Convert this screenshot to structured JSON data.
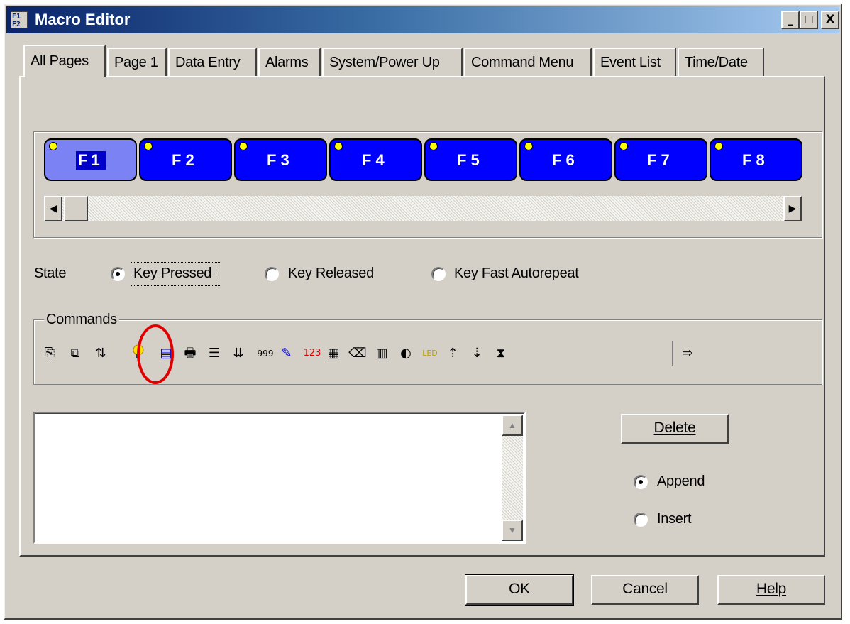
{
  "window": {
    "title": "Macro Editor",
    "icon_text": "F1\nF2",
    "caption_buttons": [
      "_",
      "□",
      "X"
    ]
  },
  "tabs": [
    {
      "label": "All Pages",
      "active": true
    },
    {
      "label": "Page 1"
    },
    {
      "label": "Data Entry"
    },
    {
      "label": "Alarms"
    },
    {
      "label": "System/Power Up"
    },
    {
      "label": "Command Menu"
    },
    {
      "label": "Event List"
    },
    {
      "label": "Time/Date"
    }
  ],
  "function_keys": [
    {
      "label": "F1",
      "selected": true
    },
    {
      "label": "F2"
    },
    {
      "label": "F3"
    },
    {
      "label": "F4"
    },
    {
      "label": "F5"
    },
    {
      "label": "F6"
    },
    {
      "label": "F7"
    },
    {
      "label": "F8"
    }
  ],
  "scroll": {
    "left_arrow": "◀",
    "right_arrow": "▶"
  },
  "state": {
    "label": "State",
    "options": [
      {
        "label": "Key Pressed",
        "selected": true
      },
      {
        "label": "Key Released",
        "selected": false
      },
      {
        "label": "Key Fast Autorepeat",
        "selected": false
      }
    ]
  },
  "commands": {
    "label": "Commands",
    "icons": [
      {
        "name": "goto-page-icon",
        "glyph": "⎘"
      },
      {
        "name": "copy-page-icon",
        "glyph": "⧉"
      },
      {
        "name": "set-tag-icon",
        "glyph": "⇅"
      },
      {
        "name": "light-bulb-icon",
        "glyph": "💡",
        "color": "#e6c000"
      },
      {
        "name": "display-window-icon",
        "glyph": "▤",
        "color": "#0000c0"
      },
      {
        "name": "print-icon",
        "glyph": "🖶"
      },
      {
        "name": "document-icon",
        "glyph": "☰"
      },
      {
        "name": "sort-list-icon",
        "glyph": "⇊"
      },
      {
        "name": "counter-999-icon",
        "glyph": "999"
      },
      {
        "name": "write-pen-icon",
        "glyph": "✎",
        "color": "#0000c0"
      },
      {
        "name": "numeric-123-icon",
        "glyph": "123",
        "color": "#e00000"
      },
      {
        "name": "table-check-icon",
        "glyph": "▦"
      },
      {
        "name": "eraser-icon",
        "glyph": "⌫"
      },
      {
        "name": "grid-cursor-icon",
        "glyph": "▥"
      },
      {
        "name": "audio-icon",
        "glyph": "◐"
      },
      {
        "name": "led-icon",
        "glyph": "LED",
        "color": "#b8a000"
      },
      {
        "name": "upload-icon",
        "glyph": "⇡"
      },
      {
        "name": "download-icon",
        "glyph": "⇣"
      },
      {
        "name": "hourglass-icon",
        "glyph": "⧗"
      },
      {
        "name": "arrow-right-icon",
        "glyph": "⇨"
      }
    ],
    "highlighted_icon": "light-bulb-icon",
    "highlight_color": "#e00000"
  },
  "listbox": {
    "up_arrow": "▲",
    "down_arrow": "▼"
  },
  "buttons": {
    "delete": "Delete",
    "ok": "OK",
    "cancel": "Cancel",
    "help": "Help"
  },
  "insert_mode": {
    "options": [
      {
        "label": "Append",
        "selected": true
      },
      {
        "label": "Insert",
        "selected": false
      }
    ]
  }
}
